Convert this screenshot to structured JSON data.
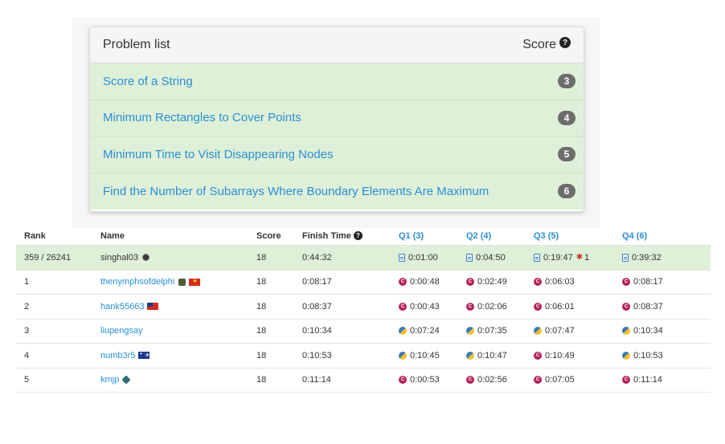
{
  "problem_list": {
    "title": "Problem list",
    "score_label": "Score",
    "help_glyph": "?",
    "problems": [
      {
        "name": "Score of a String",
        "score": "3"
      },
      {
        "name": "Minimum Rectangles to Cover Points",
        "score": "4"
      },
      {
        "name": "Minimum Time to Visit Disappearing Nodes",
        "score": "5"
      },
      {
        "name": "Find the Number of Subarrays Where Boundary Elements Are Maximum",
        "score": "6"
      }
    ]
  },
  "ranking": {
    "headers": {
      "rank": "Rank",
      "name": "Name",
      "score": "Score",
      "finish_time": "Finish Time",
      "q1": "Q1 (3)",
      "q2": "Q2 (4)",
      "q3": "Q3 (5)",
      "q4": "Q4 (6)"
    },
    "rows": [
      {
        "rank": "359 / 26241",
        "name": "singhal03",
        "score": "18",
        "finish": "0:44:32",
        "q1": "0:01:00",
        "q2": "0:04:50",
        "q3": "0:19:47",
        "q3_penalty": "1",
        "q4": "0:39:32"
      },
      {
        "rank": "1",
        "name": "thenymphsofdelphi",
        "score": "18",
        "finish": "0:08:17",
        "q1": "0:00:48",
        "q2": "0:02:49",
        "q3": "0:06:03",
        "q4": "0:08:17"
      },
      {
        "rank": "2",
        "name": "hank55663",
        "score": "18",
        "finish": "0:08:37",
        "q1": "0:00:43",
        "q2": "0:02:06",
        "q3": "0:06:01",
        "q4": "0:08:37"
      },
      {
        "rank": "3",
        "name": "liupengsay",
        "score": "18",
        "finish": "0:10:34",
        "q1": "0:07:24",
        "q2": "0:07:35",
        "q3": "0:07:47",
        "q4": "0:10:34"
      },
      {
        "rank": "4",
        "name": "numb3r5",
        "score": "18",
        "finish": "0:10:53",
        "q1": "0:10:45",
        "q2": "0:10:47",
        "q3": "0:10:49",
        "q4": "0:10:53"
      },
      {
        "rank": "5",
        "name": "kmjp",
        "score": "18",
        "finish": "0:11:14",
        "q1": "0:00:53",
        "q2": "0:02:56",
        "q3": "0:07:05",
        "q4": "0:11:14"
      }
    ]
  },
  "colors": {
    "link": "#2a8fd4",
    "solved_row": "#dff0d8",
    "badge": "#6d6d6d",
    "cpp": "#b3245a",
    "python_blue": "#3d7ab8",
    "python_yellow": "#f2c230"
  }
}
